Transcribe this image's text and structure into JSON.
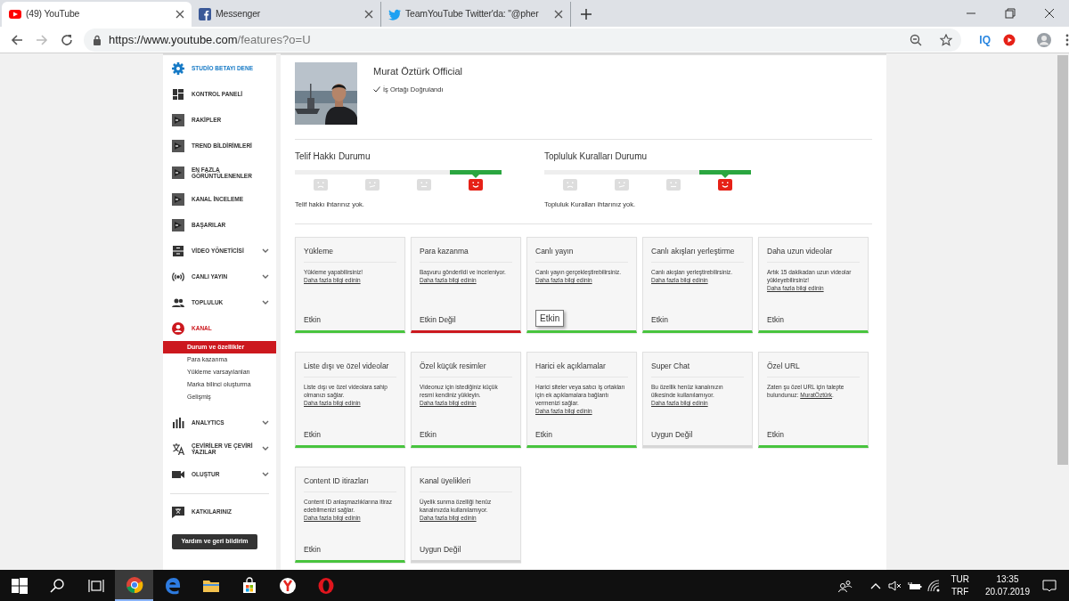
{
  "browser": {
    "tabs": [
      {
        "title": "(49) YouTube",
        "selected": true
      },
      {
        "title": "Messenger",
        "selected": false
      },
      {
        "title": "TeamYouTube Twitter'da: \"@pher",
        "selected": false
      }
    ],
    "url": {
      "host": "https://www.youtube.com",
      "path": "/features?o=U"
    },
    "extension_label": "IQ"
  },
  "sidebar": {
    "items": [
      {
        "label": "STUDİO BETAYI DENE",
        "kind": "promo",
        "selected": false,
        "expandable": false
      },
      {
        "label": "KONTROL PANELİ",
        "kind": "nav",
        "selected": false,
        "expandable": false
      },
      {
        "label": "RAKİPLER",
        "kind": "nav",
        "selected": false,
        "expandable": false
      },
      {
        "label": "TREND BİLDİRİMLERİ",
        "kind": "nav",
        "selected": false,
        "expandable": false
      },
      {
        "label": "EN FAZLA GÖRÜNTÜLENENLER",
        "kind": "nav",
        "selected": false,
        "expandable": false
      },
      {
        "label": "KANAL İNCELEME",
        "kind": "nav",
        "selected": false,
        "expandable": false
      },
      {
        "label": "BAŞARILAR",
        "kind": "nav",
        "selected": false,
        "expandable": false
      },
      {
        "label": "VİDEO YÖNETİCİSİ",
        "kind": "nav",
        "selected": false,
        "expandable": true
      },
      {
        "label": "CANLI YAYIN",
        "kind": "nav",
        "selected": false,
        "expandable": true
      },
      {
        "label": "TOPLULUK",
        "kind": "nav",
        "selected": false,
        "expandable": true
      },
      {
        "label": "KANAL",
        "kind": "nav",
        "selected": true,
        "expandable": false,
        "children": [
          {
            "label": "Durum ve özellikler",
            "selected": true
          },
          {
            "label": "Para kazanma",
            "selected": false
          },
          {
            "label": "Yükleme varsayılanları",
            "selected": false
          },
          {
            "label": "Marka bilinci oluşturma",
            "selected": false
          },
          {
            "label": "Gelişmiş",
            "selected": false
          }
        ]
      },
      {
        "label": "ANALYTICS",
        "kind": "nav",
        "selected": false,
        "expandable": true
      },
      {
        "label": "ÇEVİRİLER VE ÇEVİRİ YAZILAR",
        "kind": "nav",
        "selected": false,
        "expandable": true
      },
      {
        "label": "OLUŞTUR",
        "kind": "nav",
        "selected": false,
        "expandable": true
      }
    ],
    "footer_item": {
      "label": "KATKILARINIZ"
    },
    "feedback_button": "Yardım ve geri bildirim"
  },
  "channel": {
    "name": "Murat Öztürk Official",
    "verification": "İş Ortağı Doğrulandı"
  },
  "standings": [
    {
      "title": "Telif Hakkı Durumu",
      "levels": [
        {
          "selected": false
        },
        {
          "selected": false
        },
        {
          "selected": false
        },
        {
          "selected": true
        }
      ],
      "message": "Telif hakkı ihtarınız yok."
    },
    {
      "title": "Topluluk Kuralları Durumu",
      "levels": [
        {
          "selected": false
        },
        {
          "selected": false
        },
        {
          "selected": false
        },
        {
          "selected": true
        }
      ],
      "message": "Topluluk Kuralları ihtarınız yok."
    }
  ],
  "features": [
    {
      "title": "Yükleme",
      "text": "Yükleme yapabilirsiniz! ",
      "link": "Daha fazla bilgi edinin",
      "status": "Etkin",
      "kind": "enabled",
      "tooltip": false
    },
    {
      "title": "Para kazanma",
      "text": "Başvuru gönderildi ve inceleniyor. ",
      "link": "Daha fazla bilgi edinin",
      "status": "Etkin Değil",
      "kind": "disabled",
      "tooltip": false
    },
    {
      "title": "Canlı yayın",
      "text": "Canlı yayın gerçekleştirebilirsiniz. ",
      "link": "Daha fazla bilgi edinin",
      "status": "Etkin",
      "kind": "enabled",
      "tooltip": true
    },
    {
      "title": "Canlı akışları yerleştirme",
      "text": "Canlı akışları yerleştirebilirsiniz. ",
      "link": "Daha fazla bilgi edinin",
      "status": "Etkin",
      "kind": "enabled",
      "tooltip": false
    },
    {
      "title": "Daha uzun videolar",
      "text": "Artık 15 dakikadan uzun videolar yükleyebilirsiniz! ",
      "link": "Daha fazla bilgi edinin",
      "status": "Etkin",
      "kind": "enabled",
      "tooltip": false
    },
    {
      "title": "Liste dışı ve özel videolar",
      "text": "Liste dışı ve özel videolara sahip olmanızı sağlar. ",
      "link": "Daha fazla bilgi edinin",
      "status": "Etkin",
      "kind": "enabled",
      "tooltip": false
    },
    {
      "title": "Özel küçük resimler",
      "text": "Videonuz için istediğiniz küçük resmi kendiniz yükleyin. ",
      "link": "Daha fazla bilgi edinin",
      "status": "Etkin",
      "kind": "enabled",
      "tooltip": false
    },
    {
      "title": "Harici ek açıklamalar",
      "text": "Harici siteler veya satıcı iş ortakları için ek açıklamalara bağlantı vermenizi sağlar. ",
      "link": "Daha fazla bilgi edinin",
      "status": "Etkin",
      "kind": "enabled",
      "tooltip": false
    },
    {
      "title": "Super Chat",
      "text": "Bu özellik henüz kanalınızın ülkesinde kullanılamıyor. ",
      "link": "Daha fazla bilgi edinin",
      "status": "Uygun Değil",
      "kind": "unavailable",
      "tooltip": false
    },
    {
      "title": "Özel URL",
      "text": "Zaten şu özel URL için talepte bulundunuz: ",
      "link": "MuratÖztürk",
      "after": ".",
      "status": "Etkin",
      "kind": "enabled",
      "tooltip": false
    },
    {
      "title": "Content ID itirazları",
      "text": "Content ID anlaşmazlıklarına itiraz edebilmenizi sağlar. ",
      "link": "Daha fazla bilgi edinin",
      "status": "Etkin",
      "kind": "enabled",
      "tooltip": false
    },
    {
      "title": "Kanal üyelikleri",
      "text": "Üyelik sunma özelliği henüz kanalınızda kullanılamıyor. ",
      "link": "Daha fazla bilgi edinin",
      "status": "Uygun Değil",
      "kind": "unavailable",
      "tooltip": false
    }
  ],
  "taskbar": {
    "language": "TUR",
    "layout": "TRF",
    "time": "13:35",
    "date": "20.07.2019"
  }
}
